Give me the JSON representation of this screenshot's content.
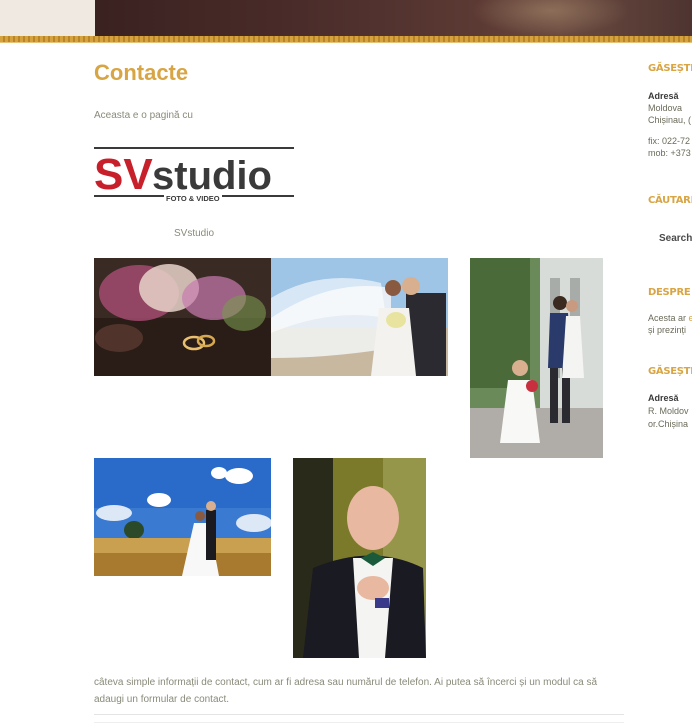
{
  "page": {
    "title": "Contacte",
    "intro": "Aceasta e o pagină cu",
    "caption": "SVstudio",
    "body_text": "câteva simple informații de contact, cum ar fi adresa sau numărul de telefon. Ai putea să încerci și un modul ca să adaugi un formular de contact."
  },
  "logo": {
    "sv": "SV",
    "studio": "studio",
    "tagline": "FOTO & VIDEO",
    "colors": {
      "red": "#c8202a",
      "dark": "#3a3a3a"
    }
  },
  "gallery": [
    {
      "name": "rings-bouquet-photo",
      "desc": "flowers and rings"
    },
    {
      "name": "veil-kiss-photo",
      "desc": "couple with veil"
    },
    {
      "name": "family-park-photo",
      "desc": "couple and child"
    },
    {
      "name": "field-couple-photo",
      "desc": "couple in wheat field"
    },
    {
      "name": "groom-portrait-photo",
      "desc": "groom portrait"
    }
  ],
  "sidebar": {
    "find_us_title": "GĂSEȘTE-",
    "address_label": "Adresă",
    "address_line1": "Moldova",
    "address_line2": "Chișinau, (",
    "phone_fix": "fix: 022-72",
    "phone_mob": "mob: +373",
    "search_title": "CĂUTARE",
    "search_placeholder": "Search",
    "about_title": "DESPRE S",
    "about_line1": "Acesta ar",
    "about_link": "e",
    "about_line2": "și prezinți",
    "find_us2_title": "GĂSEȘTE-",
    "address2_label": "Adresă",
    "address2_line1": "R. Moldov",
    "address2_line2": "or.Chișina"
  },
  "colors": {
    "accent": "#d8a545",
    "banner": "#4a2c2a",
    "text": "#8a8a7a"
  }
}
